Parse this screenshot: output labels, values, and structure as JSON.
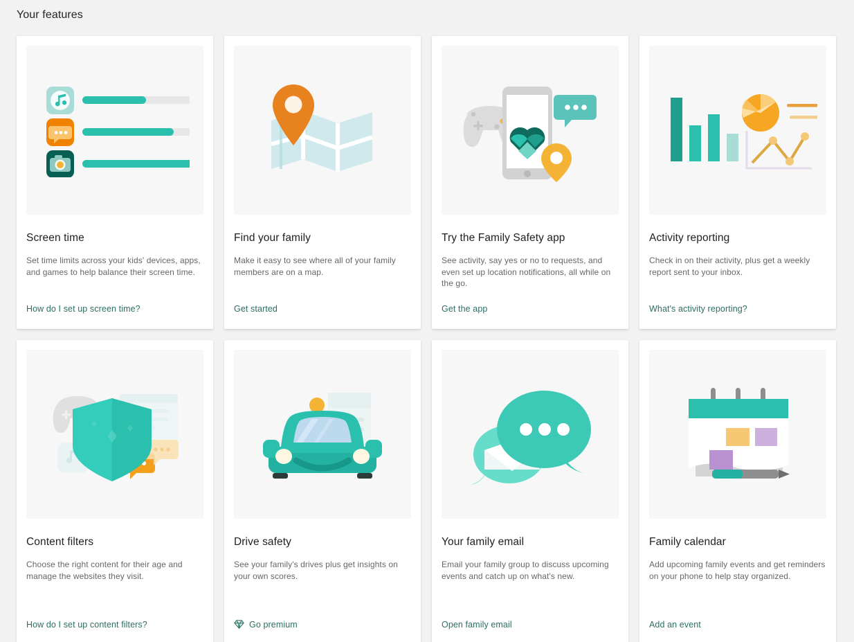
{
  "page": {
    "title": "Your features"
  },
  "colors": {
    "background": "#f2f2f2",
    "card": "#ffffff",
    "thumb": "#f7f7f7",
    "link": "#2c6e63",
    "teal": "#2bbfad",
    "teal_dark": "#0e6b5e",
    "orange": "#e8821e",
    "amber": "#f5b335",
    "purple": "#c6a9d9",
    "light_blue": "#c8e6ea"
  },
  "cards": [
    {
      "id": "screen-time",
      "icon": "app-usage-bars-illustration",
      "title": "Screen time",
      "description": "Set time limits across your kids' devices, apps, and games to help balance their screen time.",
      "link": "How do I set up screen time?",
      "link_icon": null
    },
    {
      "id": "find-your-family",
      "icon": "map-pin-illustration",
      "title": "Find your family",
      "description": "Make it easy to see where all of your family members are on a map.",
      "link": "Get started",
      "link_icon": null
    },
    {
      "id": "family-safety-app",
      "icon": "phone-gamepad-illustration",
      "title": "Try the Family Safety app",
      "description": "See activity, say yes or no to requests, and even set up location notifications, all while on the go.",
      "link": "Get the app",
      "link_icon": null
    },
    {
      "id": "activity-reporting",
      "icon": "charts-illustration",
      "title": "Activity reporting",
      "description": "Check in on their activity, plus get a weekly report sent to your inbox.",
      "link": "What's activity reporting?",
      "link_icon": null
    },
    {
      "id": "content-filters",
      "icon": "shield-illustration",
      "title": "Content filters",
      "description": "Choose the right content for their age and manage the websites they visit.",
      "link": "How do I set up content filters?",
      "link_icon": null
    },
    {
      "id": "drive-safety",
      "icon": "car-illustration",
      "title": "Drive safety",
      "description": "See your family's drives plus get insights on your own scores.",
      "link": "Go premium",
      "link_icon": "diamond-icon"
    },
    {
      "id": "family-email",
      "icon": "chat-bubbles-illustration",
      "title": "Your family email",
      "description": "Email your family group to discuss upcoming events and catch up on what's new.",
      "link": "Open family email",
      "link_icon": null
    },
    {
      "id": "family-calendar",
      "icon": "calendar-illustration",
      "title": "Family calendar",
      "description": "Add upcoming family events and get reminders on your phone to help stay organized.",
      "link": "Add an event",
      "link_icon": null
    }
  ]
}
